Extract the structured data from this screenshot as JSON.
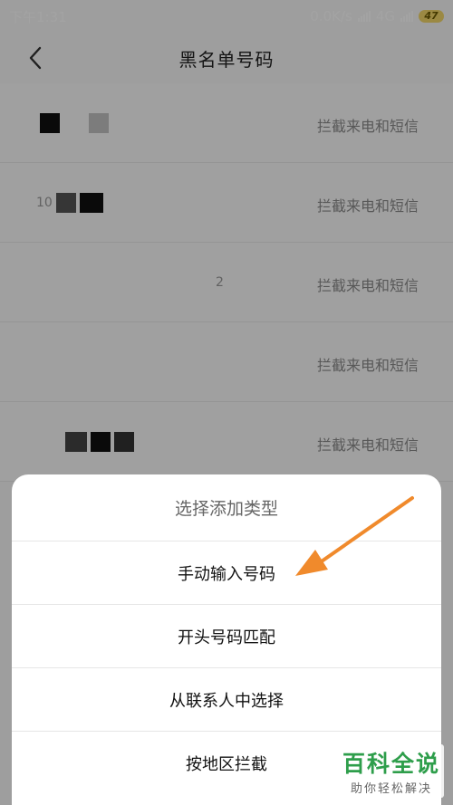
{
  "status_bar": {
    "time": "下午1:31",
    "network_speed": "0.0K/s",
    "network_type": "4G",
    "battery": "47"
  },
  "header": {
    "title": "黑名单号码"
  },
  "blacklist": {
    "items": [
      {
        "number_prefix": "",
        "number_suffix": "",
        "type": "拦截来电和短信"
      },
      {
        "number_prefix": "10",
        "number_suffix": "",
        "type": "拦截来电和短信"
      },
      {
        "number_prefix": "",
        "number_suffix": "2",
        "type": "拦截来电和短信"
      },
      {
        "number_prefix": "",
        "number_suffix": "",
        "type": "拦截来电和短信"
      },
      {
        "number_prefix": "",
        "number_suffix": "",
        "type": "拦截来电和短信"
      }
    ]
  },
  "sheet": {
    "title": "选择添加类型",
    "options": [
      "手动输入号码",
      "开头号码匹配",
      "从联系人中选择",
      "按地区拦截"
    ]
  },
  "watermark": {
    "main": "百科全说",
    "sub": "助你轻松解决"
  },
  "colors": {
    "annotation_arrow": "#f08a2c",
    "watermark_green": "#2e9e4b"
  },
  "icons": {
    "back": "chevron-left-icon",
    "annotation": "arrow-icon"
  }
}
